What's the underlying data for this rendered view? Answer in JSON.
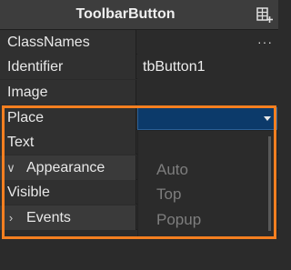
{
  "header": {
    "title": "ToolbarButton"
  },
  "properties": [
    {
      "name": "ClassNames",
      "value": ""
    },
    {
      "name": "Identifier",
      "value": "tbButton1"
    },
    {
      "name": "Image",
      "value": ""
    },
    {
      "name": "Place",
      "value": ""
    },
    {
      "name": "Text",
      "value": ""
    },
    {
      "name": "Appearance",
      "value": ""
    },
    {
      "name": "Visible",
      "value": ""
    },
    {
      "name": "Events",
      "value": ""
    }
  ],
  "classnames": {
    "ellipsis": "···"
  },
  "place_dropdown": {
    "options": [
      "Auto",
      "Top",
      "Popup"
    ]
  },
  "colors": {
    "highlight": "#f47f20",
    "selected_value_bg": "#0c3a6a"
  },
  "icons": {
    "header_icon": "grid-add-icon",
    "expand": "chevron-down-icon",
    "collapse": "chevron-right-icon"
  }
}
